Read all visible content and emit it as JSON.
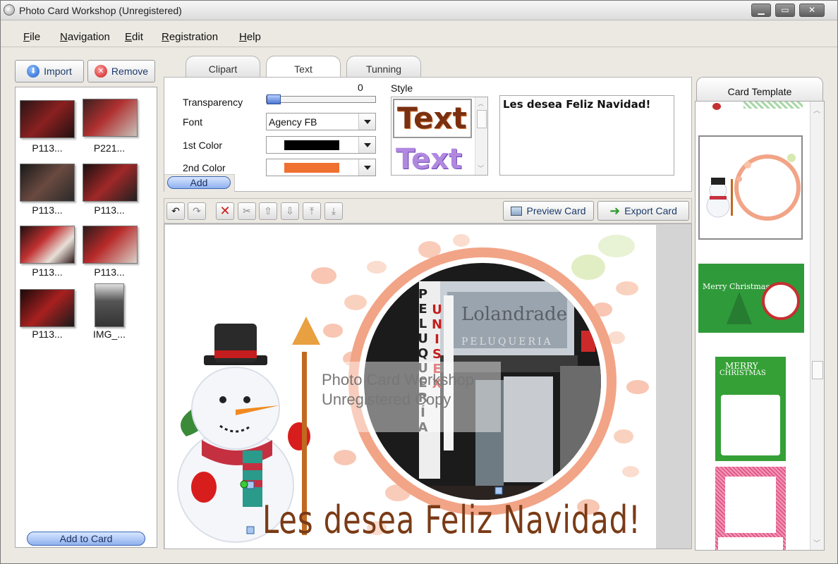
{
  "window": {
    "title": "Photo Card Workshop (Unregistered)"
  },
  "menu": [
    "File",
    "Navigation",
    "Edit",
    "Registration",
    "Help"
  ],
  "left": {
    "import_label": "Import",
    "remove_label": "Remove",
    "thumbnails": [
      "P113...",
      "P221...",
      "P113...",
      "P113...",
      "P113...",
      "P113...",
      "P113...",
      "IMG_..."
    ],
    "add_to_card_label": "Add to Card"
  },
  "tabs": [
    "Clipart",
    "Text",
    "Tunning"
  ],
  "text_panel": {
    "transparency_label": "Transparency",
    "transparency_value": "0",
    "font_label": "Font",
    "font_value": "Agency FB",
    "color1_label": "1st Color",
    "color1": "#000000",
    "color2_label": "2nd Color",
    "color2": "#f07030",
    "add_label": "Add",
    "style_label": "Style",
    "style_samples": [
      "Text",
      "Text"
    ],
    "text_value": "Les desea Feliz Navidad!"
  },
  "toolbar": {
    "preview_label": "Preview Card",
    "export_label": "Export Card"
  },
  "canvas": {
    "watermark_line1": "Photo Card Workshop",
    "watermark_line2": "Unregistered Copy",
    "greeting": "Les desea Feliz Navidad!",
    "sign_top": "Lolandrade",
    "sign_sub": "PELUQUERIA",
    "vertical_sign": "PELUQUERÍA",
    "vertical_sign2": "UNISEX",
    "accent_color": "#7a3b16"
  },
  "templates": {
    "header": "Card Template",
    "merry_christmas": "Merry Christmas",
    "merry": "MERRY",
    "christmas": "CHRISTMAS"
  }
}
